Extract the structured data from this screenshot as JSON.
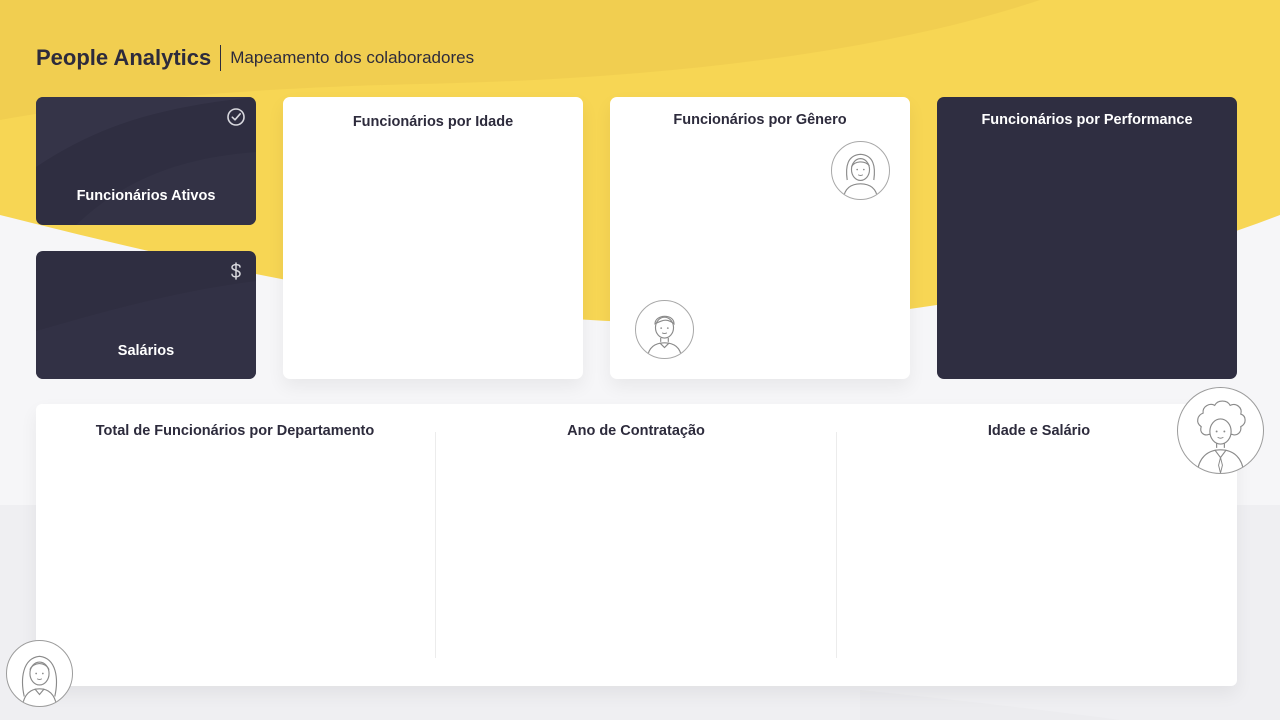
{
  "header": {
    "title": "People Analytics",
    "subtitle": "Mapeamento dos colaboradores"
  },
  "kpis": [
    {
      "label": "Funcionários Ativos",
      "icon": "check-circle-icon"
    },
    {
      "label": "Salários",
      "icon": "dollar-icon"
    }
  ],
  "cards": {
    "age": {
      "title": "Funcionários por Idade"
    },
    "gender": {
      "title": "Funcionários por Gênero"
    },
    "performance": {
      "title": "Funcionários por Performance"
    }
  },
  "bottom": {
    "department": {
      "title": "Total de Funcionários por Departamento"
    },
    "hire_year": {
      "title": "Ano de Contratação"
    },
    "age_salary": {
      "title": "Idade e Salário"
    }
  },
  "colors": {
    "accent_yellow": "#f7d654",
    "dark_card": "#2f2e41",
    "text_dark": "#2d2b3c",
    "background": "#f4f4f6"
  }
}
